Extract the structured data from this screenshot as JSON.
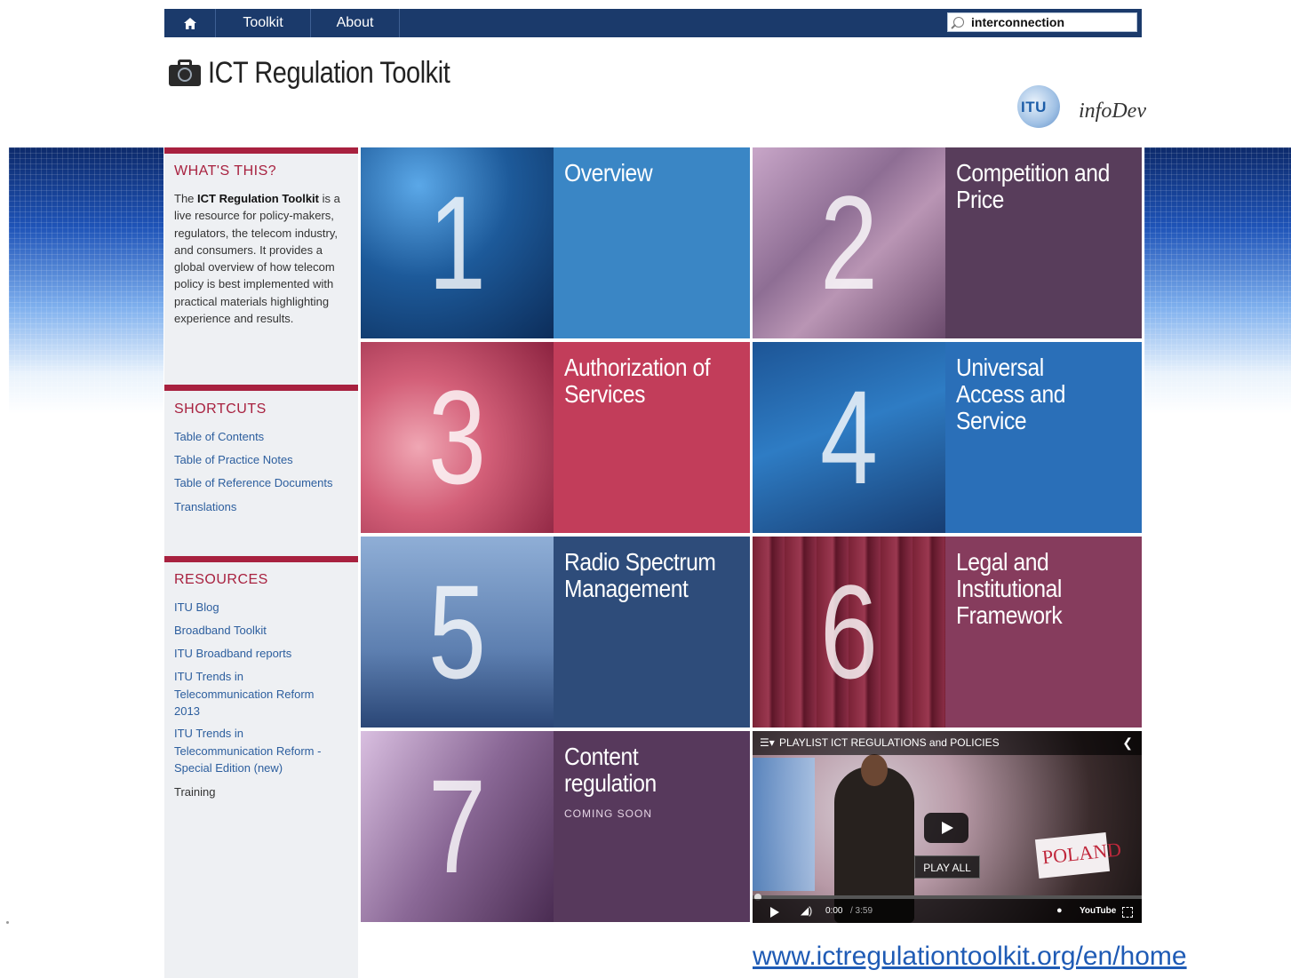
{
  "nav": {
    "home_icon": "home-icon",
    "toolkit": "Toolkit",
    "about": "About",
    "search_value": "interconnection"
  },
  "header": {
    "title": "ICT Regulation Toolkit",
    "itu_logo_text": "ITU",
    "infodev_logo_text": "infoDev"
  },
  "sidebar": {
    "whats_this": {
      "heading": "WHAT'S THIS?",
      "intro_prefix": "The ",
      "intro_bold": "ICT Regulation Toolkit",
      "intro_rest": " is a live resource for policy-makers, regulators, the telecom industry, and consumers. It provides a global overview of how telecom policy is best implemented with practical materials highlighting experience and results."
    },
    "shortcuts": {
      "heading": "SHORTCUTS",
      "items": [
        "Table of Contents",
        "Table of Practice Notes",
        "Table of Reference Documents",
        "Translations"
      ]
    },
    "resources": {
      "heading": "RESOURCES",
      "items": [
        "ITU Blog",
        "Broadband Toolkit",
        "ITU Broadband reports",
        "ITU Trends in Telecommunication Reform 2013",
        "ITU Trends in Telecommunication Reform - Special Edition (new)",
        "Training"
      ]
    }
  },
  "tiles": [
    {
      "number": "1",
      "title": "Overview"
    },
    {
      "number": "2",
      "title": "Competition and Price"
    },
    {
      "number": "3",
      "title": "Authorization of Services"
    },
    {
      "number": "4",
      "title": "Universal Access and Service"
    },
    {
      "number": "5",
      "title": "Radio Spectrum Management"
    },
    {
      "number": "6",
      "title": "Legal and Institutional Framework"
    },
    {
      "number": "7",
      "title": "Content regulation",
      "subtitle": "COMING SOON"
    }
  ],
  "video": {
    "playlist_label": "PLAYLIST",
    "playlist_title": "ICT REGULATIONS and POLICIES",
    "play_all": "PLAY ALL",
    "sign_text": "POLAND",
    "time_current": "0:00",
    "time_total": " / 3:59",
    "youtube_label": "YouTube",
    "progress": 0
  },
  "footer": {
    "url": "www.ictregulationtoolkit.org/en/home"
  },
  "colors": {
    "nav_bg": "#1b3a6b",
    "accent_red": "#a8213f",
    "link_blue": "#2c5e9e"
  }
}
